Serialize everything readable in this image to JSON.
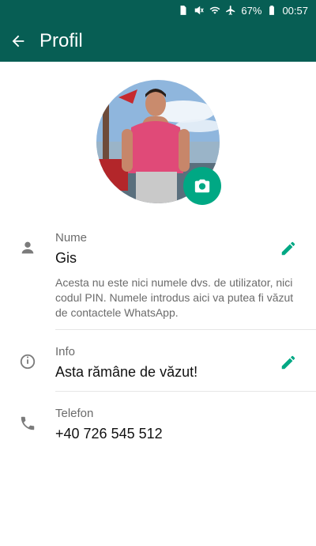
{
  "status_bar": {
    "battery_percent": "67%",
    "time": "00:57"
  },
  "appbar": {
    "title": "Profil"
  },
  "name_section": {
    "label": "Nume",
    "value": "Gis",
    "hint": "Acesta nu este nici numele dvs. de utilizator, nici codul PIN. Numele introdus aici va putea fi văzut de contactele WhatsApp."
  },
  "info_section": {
    "label": "Info",
    "value": "Asta rămâne de văzut!"
  },
  "phone_section": {
    "label": "Telefon",
    "value": "+40 726 545 512"
  },
  "colors": {
    "header": "#075e54",
    "accent": "#00a884"
  }
}
